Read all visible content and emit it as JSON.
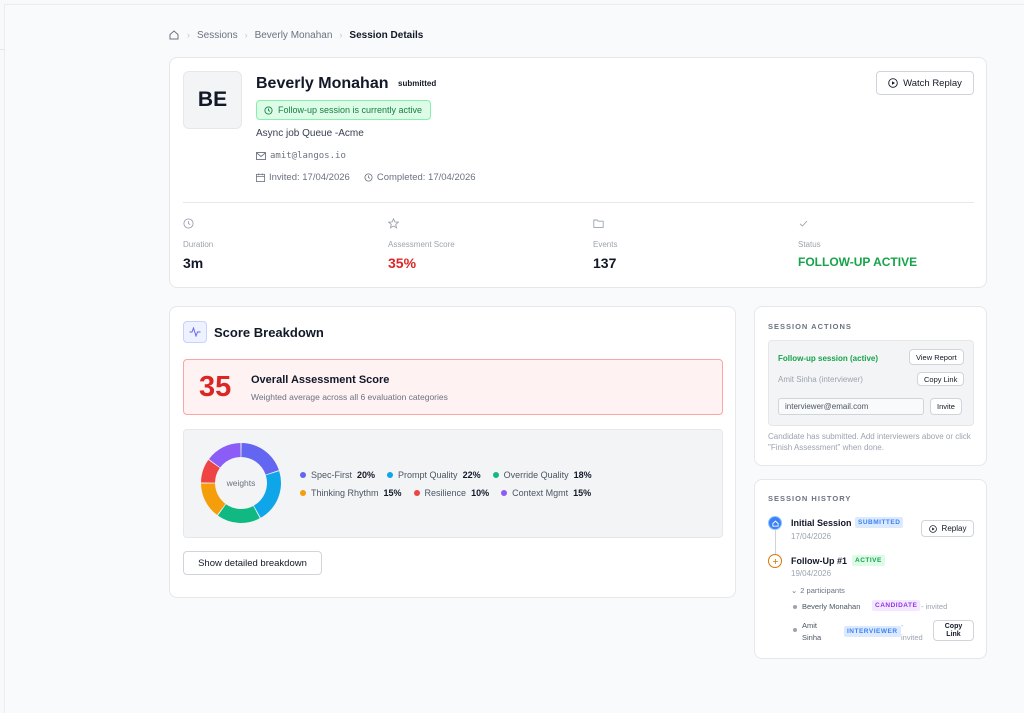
{
  "breadcrumb": {
    "home_icon": "home-icon",
    "items": [
      "Sessions",
      "Beverly Monahan"
    ],
    "current": "Session Details"
  },
  "profile": {
    "initials": "BE",
    "name": "Beverly Monahan",
    "status": "submitted",
    "active_banner": "Follow-up session is currently active",
    "job": "Async job Queue -Acme",
    "email": "amit@langos.io",
    "invited": "Invited: 17/04/2026",
    "completed": "Completed: 17/04/2026",
    "watch_label": "Watch Replay"
  },
  "stats": [
    {
      "label": "Duration",
      "value": "3m",
      "icon": "clock-icon"
    },
    {
      "label": "Assessment Score",
      "value": "35%",
      "icon": "star-icon"
    },
    {
      "label": "Events",
      "value": "137",
      "icon": "folder-icon"
    },
    {
      "label": "Status",
      "value": "FOLLOW-UP ACTIVE",
      "icon": "check-icon"
    }
  ],
  "score": {
    "title": "Score Breakdown",
    "overall_value": "35",
    "overall_title": "Overall Assessment Score",
    "overall_sub": "Weighted average across all 6 evaluation categories",
    "donut_label": "weights",
    "weights": [
      {
        "name": "Spec-First",
        "value": "20%",
        "pct": 20,
        "color": "#6366f1"
      },
      {
        "name": "Prompt Quality",
        "value": "22%",
        "pct": 22,
        "color": "#0ea5e9"
      },
      {
        "name": "Override Quality",
        "value": "18%",
        "pct": 18,
        "color": "#10b981"
      },
      {
        "name": "Thinking Rhythm",
        "value": "15%",
        "pct": 15,
        "color": "#f59e0b"
      },
      {
        "name": "Resilience",
        "value": "10%",
        "pct": 10,
        "color": "#ef4444"
      },
      {
        "name": "Context Mgmt",
        "value": "15%",
        "pct": 15,
        "color": "#8b5cf6"
      }
    ],
    "detail_button": "Show detailed breakdown"
  },
  "actions": {
    "title": "SESSION ACTIONS",
    "followup_label": "Follow-up session (active)",
    "view_report": "View Report",
    "interviewer": "Amit Sinha (interviewer)",
    "copy_link": "Copy Link",
    "email_value": "interviewer@email.com",
    "invite": "Invite",
    "note": "Candidate has submitted. Add interviewers above or click \"Finish Assessment\" when done."
  },
  "history": {
    "title": "SESSION HISTORY",
    "initial_title": "Initial Session",
    "initial_tag": "SUBMITTED",
    "initial_date": "17/04/2026",
    "replay": "Replay",
    "followup_title": "Follow-Up #1",
    "followup_tag": "ACTIVE",
    "followup_date": "19/04/2026",
    "participants": "2 participants",
    "p1_name": "Beverly Monahan",
    "p1_tag": "CANDIDATE",
    "p1_state": "- invited",
    "p2_name_1": "Amit",
    "p2_name_2": "Sinha",
    "p2_tag": "INTERVIEWER",
    "p2_state_1": "-",
    "p2_state_2": "invited",
    "copy_1": "Copy",
    "copy_2": "Link"
  }
}
